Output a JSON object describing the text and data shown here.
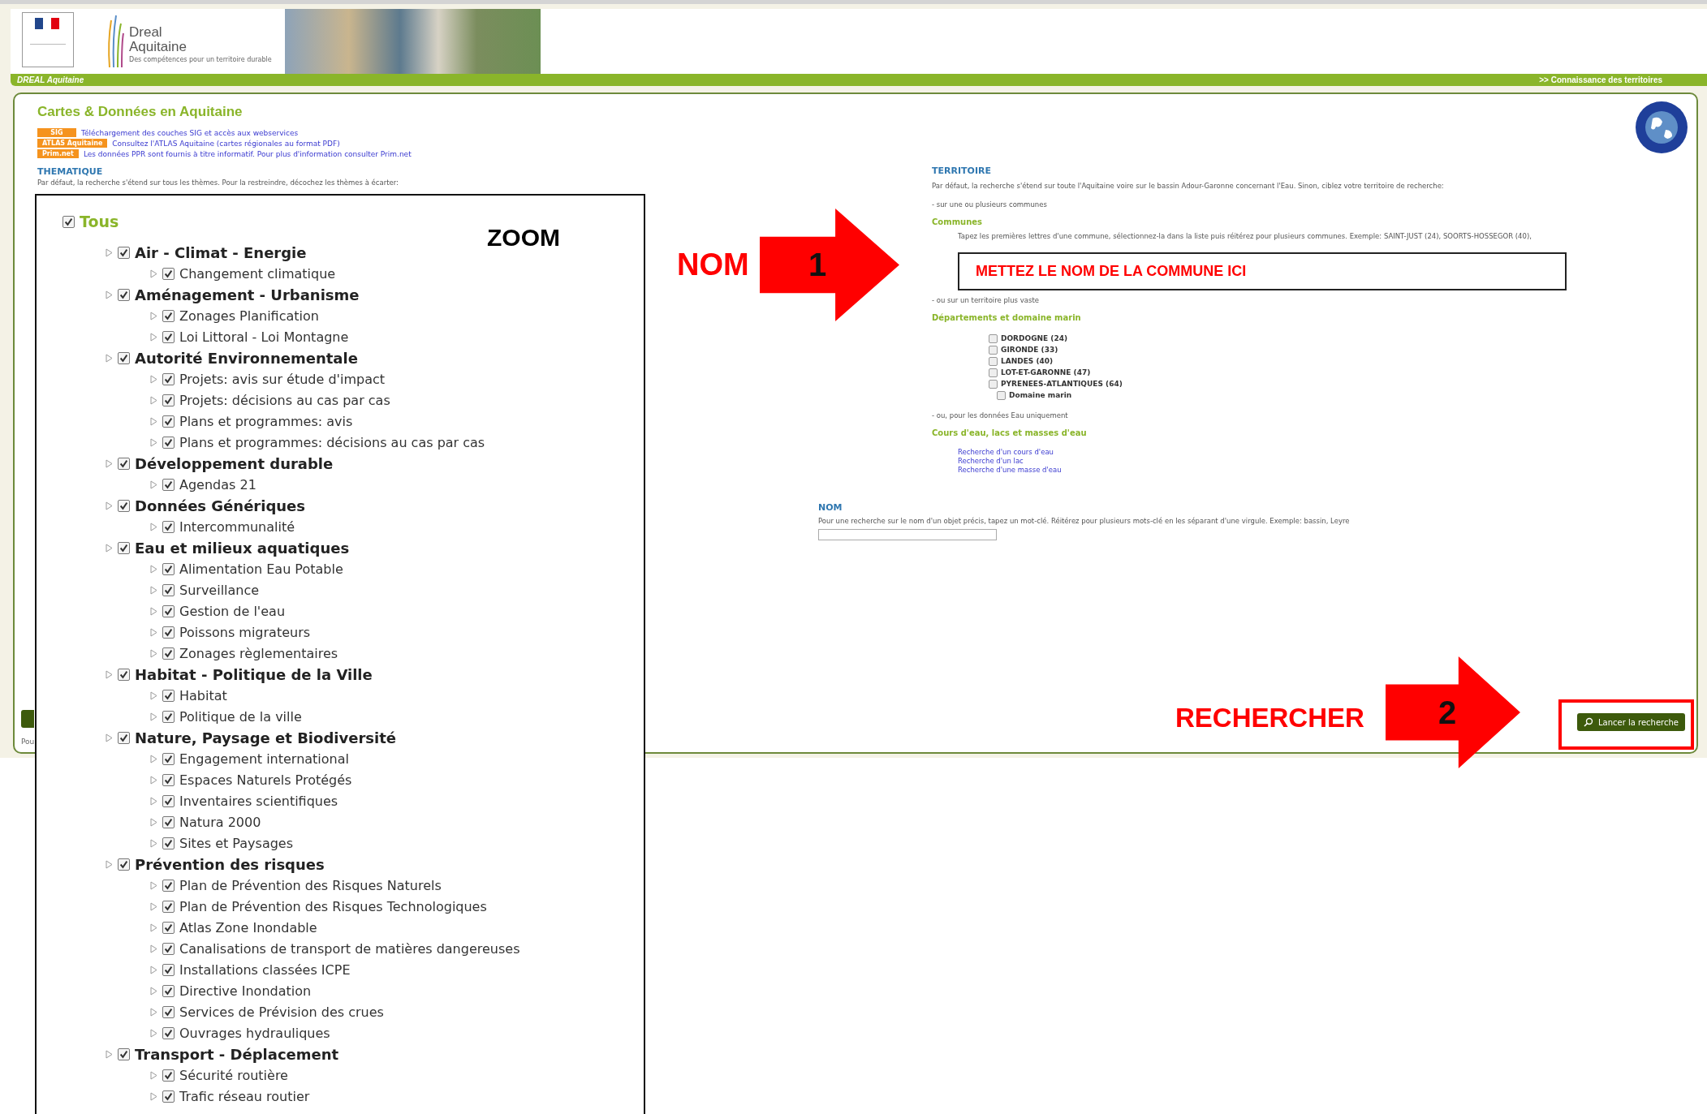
{
  "header": {
    "brand": "Dreal",
    "brand_region": "Aquitaine",
    "tagline": "Des compétences pour un territoire durable"
  },
  "nav_bar": {
    "left": "DREAL Aquitaine",
    "right": ">> Connaissance des territoires"
  },
  "page_title": "Cartes & Données en Aquitaine",
  "resources": [
    {
      "badge": "SIG",
      "text": "Téléchargement des couches SIG et accès aux webservices"
    },
    {
      "badge": "ATLAS Aquitaine",
      "text": "Consultez l'ATLAS Aquitaine (cartes régionales au format PDF)"
    },
    {
      "badge": "Prim.net",
      "text": "Les données PPR sont fournis à titre informatif. Pour plus d'information consulter Prim.net"
    }
  ],
  "thematique": {
    "heading": "THEMATIQUE",
    "description": "Par défaut, la recherche s'étend sur tous les thèmes. Pour la restreindre, décochez les thèmes à écarter:"
  },
  "territoire": {
    "heading": "TERRITOIRE",
    "description": "Par défaut, la recherche s'étend sur toute l'Aquitaine voire sur le bassin Adour-Garonne concernant l'Eau. Sinon, ciblez votre territoire de recherche:",
    "communes_intro": "- sur une ou plusieurs communes",
    "communes_heading": "Communes",
    "communes_help": "Tapez les premières lettres d'une commune, sélectionnez-la dans la liste puis réitérez pour plusieurs communes. Exemple: SAINT-JUST (24), SOORTS-HOSSEGOR (40),",
    "commune_annotation": "METTEZ LE NOM DE LA COMMUNE ICI",
    "wider_intro": "- ou sur un territoire plus vaste",
    "departments_heading": "Départements et domaine marin",
    "departments": [
      {
        "label": "DORDOGNE (24)",
        "checked": false
      },
      {
        "label": "GIRONDE (33)",
        "checked": false
      },
      {
        "label": "LANDES (40)",
        "checked": false
      },
      {
        "label": "LOT-ET-GARONNE (47)",
        "checked": false
      },
      {
        "label": "PYRENEES-ATLANTIQUES (64)",
        "checked": false
      }
    ],
    "marine_domain": {
      "label": "Domaine marin",
      "checked": false
    },
    "water_intro": "- ou, pour les données Eau uniquement",
    "water_heading": "Cours d'eau, lacs et masses d'eau",
    "water_links": [
      "Recherche d'un cours d'eau",
      "Recherche d'un lac",
      "Recherche d'une masse d'eau"
    ]
  },
  "nom": {
    "heading": "NOM",
    "description": "Pour une recherche sur le nom d'un objet précis, tapez un mot-clé. Réitérez pour plusieurs mots-clé en les séparant d'une virgule. Exemple: bassin, Leyre"
  },
  "search_button": "Lancer la recherche",
  "footer_fragment": "Pou",
  "annotations": [
    {
      "label": "NOM",
      "number": "1"
    },
    {
      "label": "RECHERCHER",
      "number": "2"
    }
  ],
  "zoom_panel": {
    "label": "ZOOM",
    "root": {
      "label": "Tous",
      "checked": true,
      "children": [
        {
          "label": "Air - Climat - Energie",
          "checked": true,
          "children": [
            {
              "label": "Changement climatique",
              "checked": true
            }
          ]
        },
        {
          "label": "Aménagement - Urbanisme",
          "checked": true,
          "children": [
            {
              "label": "Zonages Planification",
              "checked": true
            },
            {
              "label": "Loi Littoral - Loi Montagne",
              "checked": true
            }
          ]
        },
        {
          "label": "Autorité Environnementale",
          "checked": true,
          "children": [
            {
              "label": "Projets: avis sur étude d'impact",
              "checked": true
            },
            {
              "label": "Projets: décisions au cas par cas",
              "checked": true
            },
            {
              "label": "Plans et programmes: avis",
              "checked": true
            },
            {
              "label": "Plans et programmes: décisions au cas par cas",
              "checked": true
            }
          ]
        },
        {
          "label": "Développement durable",
          "checked": true,
          "children": [
            {
              "label": "Agendas 21",
              "checked": true
            }
          ]
        },
        {
          "label": "Données Génériques",
          "checked": true,
          "children": [
            {
              "label": "Intercommunalité",
              "checked": true
            }
          ]
        },
        {
          "label": "Eau et milieux aquatiques",
          "checked": true,
          "children": [
            {
              "label": "Alimentation Eau Potable",
              "checked": true
            },
            {
              "label": "Surveillance",
              "checked": true
            },
            {
              "label": "Gestion de l'eau",
              "checked": true
            },
            {
              "label": "Poissons migrateurs",
              "checked": true
            },
            {
              "label": "Zonages règlementaires",
              "checked": true
            }
          ]
        },
        {
          "label": "Habitat - Politique de la Ville",
          "checked": true,
          "children": [
            {
              "label": "Habitat",
              "checked": true
            },
            {
              "label": "Politique de la ville",
              "checked": true
            }
          ]
        },
        {
          "label": "Nature, Paysage et Biodiversité",
          "checked": true,
          "children": [
            {
              "label": "Engagement international",
              "checked": true
            },
            {
              "label": "Espaces Naturels Protégés",
              "checked": true
            },
            {
              "label": "Inventaires scientifiques",
              "checked": true
            },
            {
              "label": "Natura 2000",
              "checked": true
            },
            {
              "label": "Sites et Paysages",
              "checked": true
            }
          ]
        },
        {
          "label": "Prévention des risques",
          "checked": true,
          "children": [
            {
              "label": "Plan de Prévention des Risques Naturels",
              "checked": true
            },
            {
              "label": "Plan de Prévention des Risques Technologiques",
              "checked": true
            },
            {
              "label": "Atlas Zone Inondable",
              "checked": true
            },
            {
              "label": "Canalisations de transport de matières dangereuses",
              "checked": true
            },
            {
              "label": "Installations classées ICPE",
              "checked": true
            },
            {
              "label": "Directive Inondation",
              "checked": true
            },
            {
              "label": "Services de Prévision des crues",
              "checked": true
            },
            {
              "label": "Ouvrages hydrauliques",
              "checked": true
            }
          ]
        },
        {
          "label": "Transport - Déplacement",
          "checked": true,
          "children": [
            {
              "label": "Sécurité routière",
              "checked": true
            },
            {
              "label": "Trafic réseau routier",
              "checked": true
            }
          ]
        }
      ]
    }
  }
}
